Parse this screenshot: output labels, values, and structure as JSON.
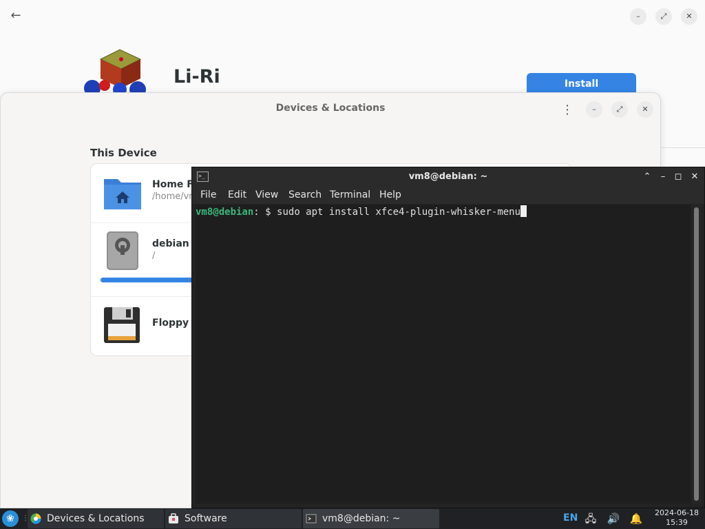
{
  "software": {
    "app_name": "Li-Ri",
    "install_label": "Install"
  },
  "devices": {
    "title": "Devices & Locations",
    "section_title": "This Device",
    "items": [
      {
        "name": "Home F",
        "path": "/home/vr",
        "icon": "home-folder-icon"
      },
      {
        "name": "debian",
        "path": "/",
        "icon": "drive-icon",
        "usage_fraction": 0.2
      },
      {
        "name": "Floppy",
        "path": "",
        "icon": "floppy-icon"
      }
    ]
  },
  "terminal": {
    "title": "vm8@debian: ~",
    "menu": [
      "File",
      "Edit",
      "View",
      "Search",
      "Terminal",
      "Help"
    ],
    "prompt_user": "vm8@debian",
    "prompt_sep": ":",
    "prompt_tail": " $ ",
    "command": "sudo apt install xfce4-plugin-whisker-menu"
  },
  "taskbar": {
    "tasks": [
      {
        "label": "Devices & Locations",
        "icon": "devices-app-icon"
      },
      {
        "label": "Software",
        "icon": "software-app-icon"
      },
      {
        "label": "vm8@debian: ~",
        "icon": "terminal-app-icon"
      }
    ],
    "language": "EN",
    "date": "2024-06-18",
    "time": "15:39",
    "tray_icons": [
      "network-icon",
      "volume-icon",
      "notifications-icon"
    ]
  },
  "colors": {
    "accent": "#3584e4",
    "prompt_green": "#3ab77a",
    "terminal_bg": "#1e1e1e",
    "taskbar_bg": "#1f2124"
  }
}
